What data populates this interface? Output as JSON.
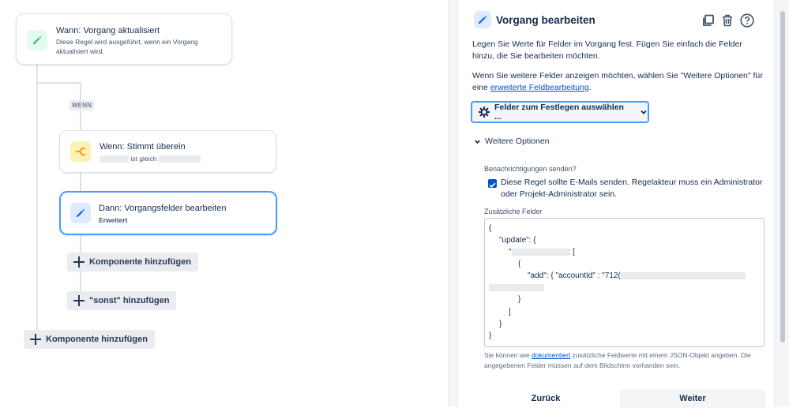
{
  "flow": {
    "trigger": {
      "title": "Wann: Vorgang aktualisiert",
      "desc": "Diese Regel wird ausgeführt, wenn ein Vorgang aktualisiert wird."
    },
    "wenn_label": "WENN",
    "condition": {
      "title": "Wenn: Stimmt überein",
      "operator": "ist gleich"
    },
    "action": {
      "title": "Dann: Vorgangsfelder bearbeiten",
      "subtitle": "Erweitert"
    },
    "add_component_inner": "Komponente hinzufügen",
    "add_else": "\"sonst\" hinzufügen",
    "add_component_outer": "Komponente hinzufügen"
  },
  "panel": {
    "title": "Vorgang bearbeiten",
    "intro": "Legen Sie Werte für Felder im Vorgang fest. Fügen Sie einfach die Felder hinzu, die Sie bearbeiten möchten.",
    "more_fields_text": "Wenn Sie weitere Felder anzeigen möchten, wählen Sie \"Weitere Optionen\" für eine",
    "more_fields_link": "erweiterte Feldbearbeitung",
    "more_fields_end": ".",
    "select_fields": "Felder zum Festlegen auswählen ...",
    "more_options": "Weitere Optionen",
    "notifications_label": "Benachrichtigungen senden?",
    "notifications_checkbox": "Diese Regel sollte E-Mails senden. Regelakteur muss ein Administrator oder Projekt-Administrator sein.",
    "notifications_checked": true,
    "additional_fields_label": "Zusätzliche Felder",
    "json": {
      "l1": "{",
      "l2": "\"update\": {",
      "l3_quote": "\"",
      "l3_end": ": [",
      "l4": "{",
      "l5": "\"add\": { \"accountId\" : \"712(",
      "l6": "}",
      "l7": "}",
      "l8": "]",
      "l9": "}",
      "l10": "}"
    },
    "help_pre": "Sie können wie ",
    "help_link": "dokumentiert",
    "help_post": " zusätzliche Feldwerte mit einem JSON-Objekt angeben. Die angegebenen Felder müssen auf dem Bildschirm vorhanden sein.",
    "back": "Zurück",
    "next": "Weiter"
  },
  "colors": {
    "trigger_icon_bg": "#e3fcef",
    "trigger_icon": "#36b37e",
    "condition_icon_bg": "#fff0b3",
    "condition_icon": "#ff8b00",
    "action_icon_bg": "#deebff",
    "action_icon": "#0065ff",
    "accent": "#0052cc",
    "selected_border": "#4c9aff"
  }
}
